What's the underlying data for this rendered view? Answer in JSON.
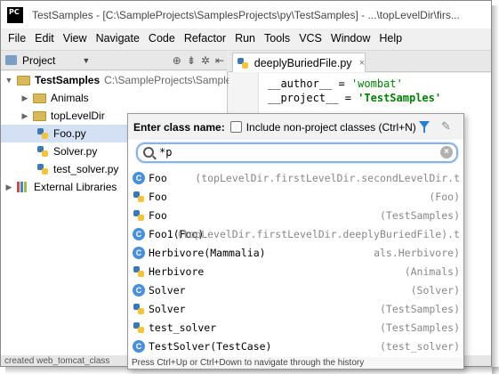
{
  "window": {
    "title": "TestSamples - [C:\\SampleProjects\\SamplesProjects\\py\\TestSamples] - ...\\topLevelDir\\firs..."
  },
  "menu": [
    {
      "label": "File"
    },
    {
      "label": "Edit"
    },
    {
      "label": "View"
    },
    {
      "label": "Navigate"
    },
    {
      "label": "Code"
    },
    {
      "label": "Refactor"
    },
    {
      "label": "Run"
    },
    {
      "label": "Tools"
    },
    {
      "label": "VCS"
    },
    {
      "label": "Window"
    },
    {
      "label": "Help"
    }
  ],
  "project_panel": {
    "tab_label": "Project",
    "tree": [
      {
        "label": "TestSamples",
        "path": "C:\\SampleProjects\\Samples"
      },
      {
        "label": "Animals"
      },
      {
        "label": "topLevelDir"
      },
      {
        "label": "Foo.py"
      },
      {
        "label": "Solver.py"
      },
      {
        "label": "test_solver.py"
      },
      {
        "label": "External Libraries"
      }
    ]
  },
  "editor": {
    "tab_label": "deeplyBuriedFile.py",
    "lines": [
      {
        "name": "__author__",
        "op": " = ",
        "value": "'wombat'"
      },
      {
        "name": "__project__",
        "op": " = ",
        "value": "'TestSamples'"
      }
    ]
  },
  "popup": {
    "title": "Enter class name:",
    "include_label": "Include non-project classes (Ctrl+N)",
    "search_value": "*p",
    "items": [
      {
        "name": "Foo",
        "path": "(topLevelDir.firstLevelDir.secondLevelDir.t",
        "icon": "class"
      },
      {
        "name": "Foo",
        "path": "(Foo)",
        "icon": "python"
      },
      {
        "name": "Foo",
        "path": "(TestSamples)",
        "icon": "python"
      },
      {
        "name": "Foo1(Foo)",
        "path": "(topLevelDir.firstLevelDir.deeplyBuriedFile).t",
        "icon": "class"
      },
      {
        "name": "Herbivore(Mammalia)",
        "path": "als.Herbivore)",
        "icon": "class"
      },
      {
        "name": "Herbivore",
        "path": "(Animals)",
        "icon": "python"
      },
      {
        "name": "Solver",
        "path": "(Solver)",
        "icon": "class"
      },
      {
        "name": "Solver",
        "path": "(TestSamples)",
        "icon": "python"
      },
      {
        "name": "test_solver",
        "path": "(TestSamples)",
        "icon": "python"
      },
      {
        "name": "TestSolver(TestCase)",
        "path": "(test_solver)",
        "icon": "class"
      }
    ],
    "footer": "Press Ctrl+Up or Ctrl+Down to navigate through the history"
  },
  "status_bar": {
    "text": "created   web_tomcat_class"
  }
}
